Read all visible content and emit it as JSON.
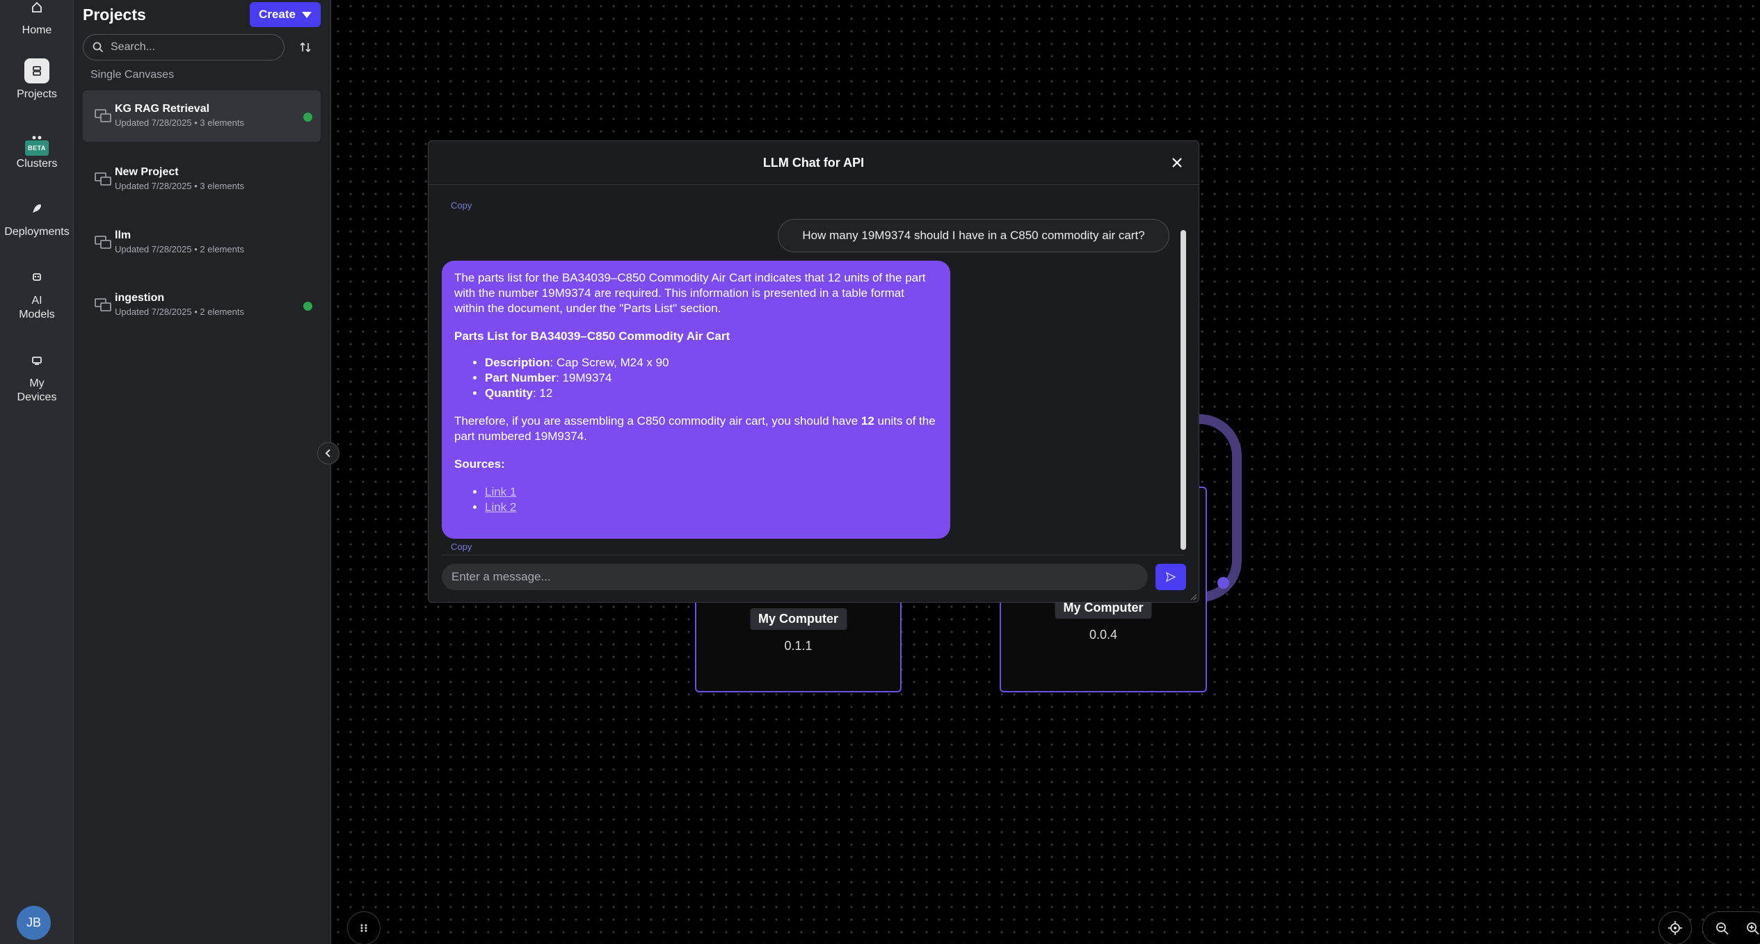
{
  "rail": {
    "items": [
      {
        "label": "Home",
        "icon": "home-icon"
      },
      {
        "label": "Projects",
        "icon": "projects-icon"
      },
      {
        "label": "Clusters",
        "icon": "clusters-icon",
        "badge": "BETA"
      },
      {
        "label": "Deployments",
        "icon": "rocket-icon"
      },
      {
        "label": "AI Models",
        "icon": "ai-models-icon"
      },
      {
        "label": "My Devices",
        "icon": "devices-icon"
      }
    ],
    "avatar_initials": "JB"
  },
  "projects_panel": {
    "title": "Projects",
    "create_label": "Create",
    "search_placeholder": "Search...",
    "section_label": "Single Canvases",
    "projects": [
      {
        "name": "KG RAG Retrieval",
        "meta": "Updated 7/28/2025 • 3 elements",
        "status": "online"
      },
      {
        "name": "New Project",
        "meta": "Updated 7/28/2025 • 3 elements",
        "status": ""
      },
      {
        "name": "llm",
        "meta": "Updated 7/28/2025 • 2 elements",
        "status": ""
      },
      {
        "name": "ingestion",
        "meta": "Updated 7/28/2025 • 2 elements",
        "status": "online"
      }
    ]
  },
  "canvas": {
    "nodes": [
      {
        "device": "My Computer",
        "version": "0.1.1"
      },
      {
        "device": "My Computer",
        "version": "0.0.4"
      }
    ]
  },
  "chat_modal": {
    "title": "LLM Chat for API",
    "copy_label": "Copy",
    "user_message": "How many 19M9374 should I have in a C850 commodity air cart?",
    "assistant": {
      "intro": "The parts list for the BA34039–C850 Commodity Air Cart indicates that 12 units of the part with the number 19M9374 are required. This information is presented in a table format within the document, under the \"Parts List\" section.",
      "heading": "Parts List for BA34039–C850 Commodity Air Cart",
      "items": [
        {
          "key": "Description",
          "value": ": Cap Screw, M24 x 90"
        },
        {
          "key": "Part Number",
          "value": ": 19M9374"
        },
        {
          "key": "Quantity",
          "value": ": 12"
        }
      ],
      "conclusion_pre": "Therefore, if you are assembling a C850 commodity air cart, you should have ",
      "conclusion_bold": "12",
      "conclusion_post": " units of the part numbered 19M9374.",
      "sources_heading": "Sources:",
      "sources": [
        "Link 1",
        "Link 2"
      ]
    },
    "input_placeholder": "Enter a message..."
  },
  "colors": {
    "accent": "#4a3cf0",
    "assistant_bubble": "#7d4cf0",
    "node_border": "#6b52e0",
    "status_online": "#2ea44f"
  }
}
